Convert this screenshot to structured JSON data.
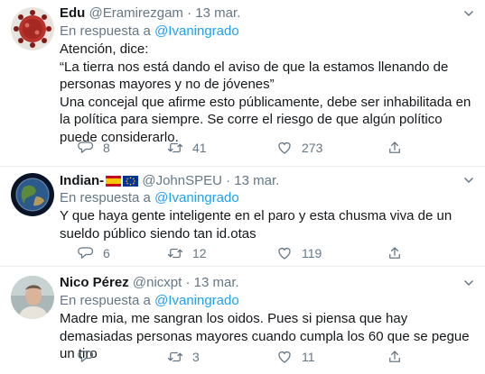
{
  "reply_prefix": "En respuesta a",
  "tweets": [
    {
      "name": "Edu",
      "handle": "@Eramirezgam",
      "separator": "·",
      "date": "13 mar.",
      "reply_to": "@Ivaningrado",
      "lines": [
        "Atención, dice:",
        "“La tierra nos está dando el aviso de que la estamos llenando de personas mayores y no de jóvenes”",
        "Una concejal que afirme esto públicamente, debe ser inhabilitada en la política para siempre. Se corre el riesgo de que algún  político puede considerarlo."
      ],
      "replies": "8",
      "retweets": "41",
      "likes": "273"
    },
    {
      "name": "Indian-",
      "name_flags": [
        "spain-flag-icon",
        "eu-flag-icon"
      ],
      "handle": "@JohnSPEU",
      "separator": "·",
      "date": "13 mar.",
      "reply_to": "@Ivaningrado",
      "lines": [
        "Y que haya gente inteligente en el paro y esta chusma viva de un sueldo público siendo tan id.otas"
      ],
      "replies": "6",
      "retweets": "12",
      "likes": "119"
    },
    {
      "name": "Nico Pérez",
      "handle": "@nicxpt",
      "separator": "·",
      "date": "13 mar.",
      "reply_to": "@Ivaningrado",
      "lines": [
        "Madre mia, me sangran los oidos. Pues si piensa que hay demasiadas personas mayores cuando cumpla los 60 que se pegue un tiro"
      ],
      "replies": "",
      "retweets": "3",
      "likes": "11"
    }
  ],
  "colors": {
    "text": "#14171a",
    "secondary": "#657786",
    "link": "#1da1f2",
    "divider": "#e6ecf0"
  }
}
